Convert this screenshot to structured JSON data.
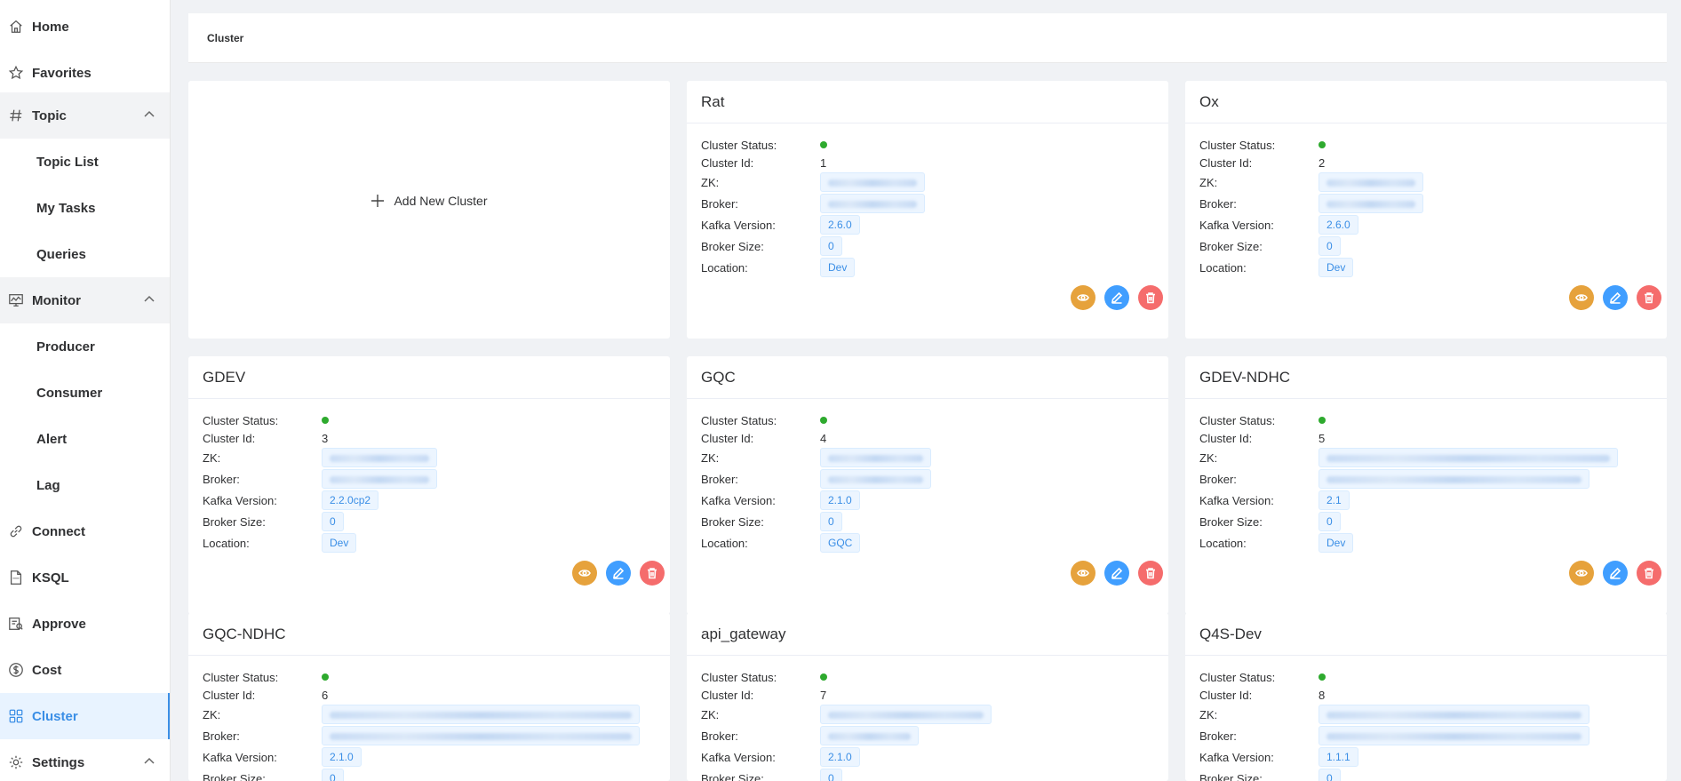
{
  "sidebar": {
    "items": [
      {
        "label": "Home",
        "icon": "home-icon"
      },
      {
        "label": "Favorites",
        "icon": "star-icon"
      },
      {
        "label": "Topic",
        "icon": "hash-icon",
        "expanded": true
      },
      {
        "label": "Topic List"
      },
      {
        "label": "My Tasks"
      },
      {
        "label": "Queries"
      },
      {
        "label": "Monitor",
        "icon": "monitor-icon",
        "expanded": true
      },
      {
        "label": "Producer"
      },
      {
        "label": "Consumer"
      },
      {
        "label": "Alert"
      },
      {
        "label": "Lag"
      },
      {
        "label": "Connect",
        "icon": "link-icon"
      },
      {
        "label": "KSQL",
        "icon": "sql-file-icon"
      },
      {
        "label": "Approve",
        "icon": "approve-icon"
      },
      {
        "label": "Cost",
        "icon": "dollar-icon"
      },
      {
        "label": "Cluster",
        "icon": "grid-icon",
        "active": true
      },
      {
        "label": "Settings",
        "icon": "gear-icon",
        "expanded": true
      }
    ]
  },
  "breadcrumb": "Cluster",
  "add_card": {
    "label": "Add New Cluster"
  },
  "labels": {
    "status": "Cluster Status:",
    "id": "Cluster Id:",
    "zk": "ZK:",
    "broker": "Broker:",
    "kafka_version": "Kafka Version:",
    "broker_size": "Broker Size:",
    "location": "Location:"
  },
  "colors": {
    "accent": "#3a8ee6",
    "status_ok": "#2eaa2e",
    "view": "#e6a23c",
    "edit": "#409eff",
    "delete": "#f56c6c"
  },
  "clusters": [
    {
      "name": "Rat",
      "id": "1",
      "kafka_version": "2.6.0",
      "broker_size": "0",
      "location": "Dev"
    },
    {
      "name": "Ox",
      "id": "2",
      "kafka_version": "2.6.0",
      "broker_size": "0",
      "location": "Dev"
    },
    {
      "name": "GDEV",
      "id": "3",
      "kafka_version": "2.2.0cp2",
      "broker_size": "0",
      "location": "Dev"
    },
    {
      "name": "GQC",
      "id": "4",
      "kafka_version": "2.1.0",
      "broker_size": "0",
      "location": "GQC"
    },
    {
      "name": "GDEV-NDHC",
      "id": "5",
      "kafka_version": "2.1",
      "broker_size": "0",
      "location": "Dev"
    },
    {
      "name": "GQC-NDHC",
      "id": "6",
      "kafka_version": "2.1.0",
      "broker_size": "0",
      "location": ""
    },
    {
      "name": "api_gateway",
      "id": "7",
      "kafka_version": "2.1.0",
      "broker_size": "0",
      "location": ""
    },
    {
      "name": "Q4S-Dev",
      "id": "8",
      "kafka_version": "1.1.1",
      "broker_size": "0",
      "location": ""
    }
  ]
}
